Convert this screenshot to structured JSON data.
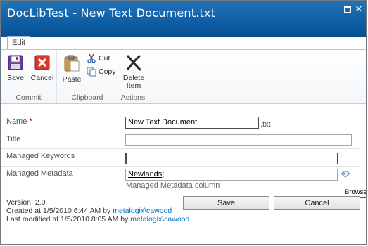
{
  "window": {
    "title": "DocLibTest - New Text Document.txt"
  },
  "ribbon": {
    "tab": "Edit",
    "groups": {
      "commit": {
        "label": "Commit",
        "save": "Save",
        "cancel": "Cancel"
      },
      "clipboard": {
        "label": "Clipboard",
        "paste": "Paste",
        "cut": "Cut",
        "copy": "Copy"
      },
      "actions": {
        "label": "Actions",
        "delete_line1": "Delete",
        "delete_line2": "Item"
      }
    }
  },
  "form": {
    "name": {
      "label": "Name",
      "required_marker": "*",
      "value": "New Text Document",
      "extension": ".txt"
    },
    "title": {
      "label": "Title",
      "value": ""
    },
    "keywords": {
      "label": "Managed Keywords",
      "value": ""
    },
    "metadata": {
      "label": "Managed Metadata",
      "term": "Newlands",
      "separator": ";",
      "hint": "Managed Metadata column",
      "browse_tooltip": "Browse"
    }
  },
  "footer": {
    "version": "Version: 2.0",
    "created_prefix": "Created at 1/5/2010 6:44 AM  by",
    "created_user": "metalogix\\cawood",
    "modified_prefix": "Last modified at 1/5/2010 8:05 AM  by",
    "modified_user": "metalogix\\cawood",
    "save": "Save",
    "cancel": "Cancel"
  },
  "colors": {
    "titlebar": "#0e5ea6",
    "link": "#0072bc",
    "required": "#bb0000"
  },
  "icons": [
    "maximize-icon",
    "close-icon",
    "save-icon",
    "cancel-icon",
    "paste-icon",
    "cut-icon",
    "copy-icon",
    "delete-icon",
    "browse-icon"
  ]
}
